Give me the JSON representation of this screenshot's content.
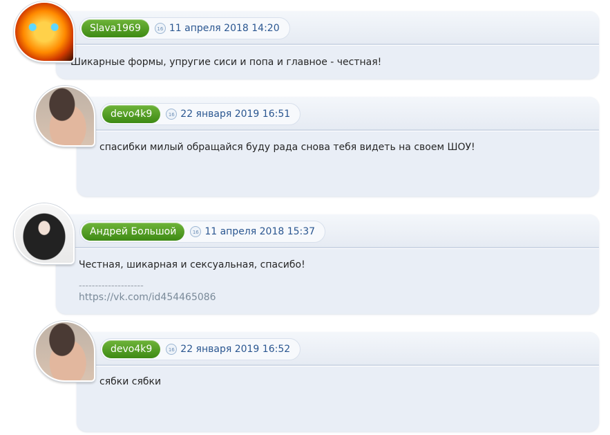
{
  "comments": [
    {
      "author": "Slava1969",
      "date": "11 апреля 2018 14:20",
      "text": "Шикарные формы, упругие сиси и попа и главное - честная!",
      "avatar_icon": "fire-cat-avatar"
    },
    {
      "author": "devo4k9",
      "date": "22 января 2019 16:51",
      "text": "спасибки милый обращайся буду рада снова тебя видеть на своем ШОУ!",
      "avatar_icon": "girl-avatar"
    },
    {
      "author": "Андрей Большой",
      "date": "11 апреля 2018 15:37",
      "text": "Честная, шикарная и сексуальная, спасибо!",
      "signature_sep": "--------------------",
      "signature_link": "https://vk.com/id454465086",
      "avatar_icon": "hooded-man-avatar"
    },
    {
      "author": "devo4k9",
      "date": "22 января 2019 16:52",
      "text": "сябки сябки",
      "avatar_icon": "girl-avatar"
    }
  ],
  "clock_icon_label": "16",
  "colors": {
    "author_badge": "#4f9b22",
    "date_text": "#2a5690",
    "card_bg": "#e9eef6"
  }
}
